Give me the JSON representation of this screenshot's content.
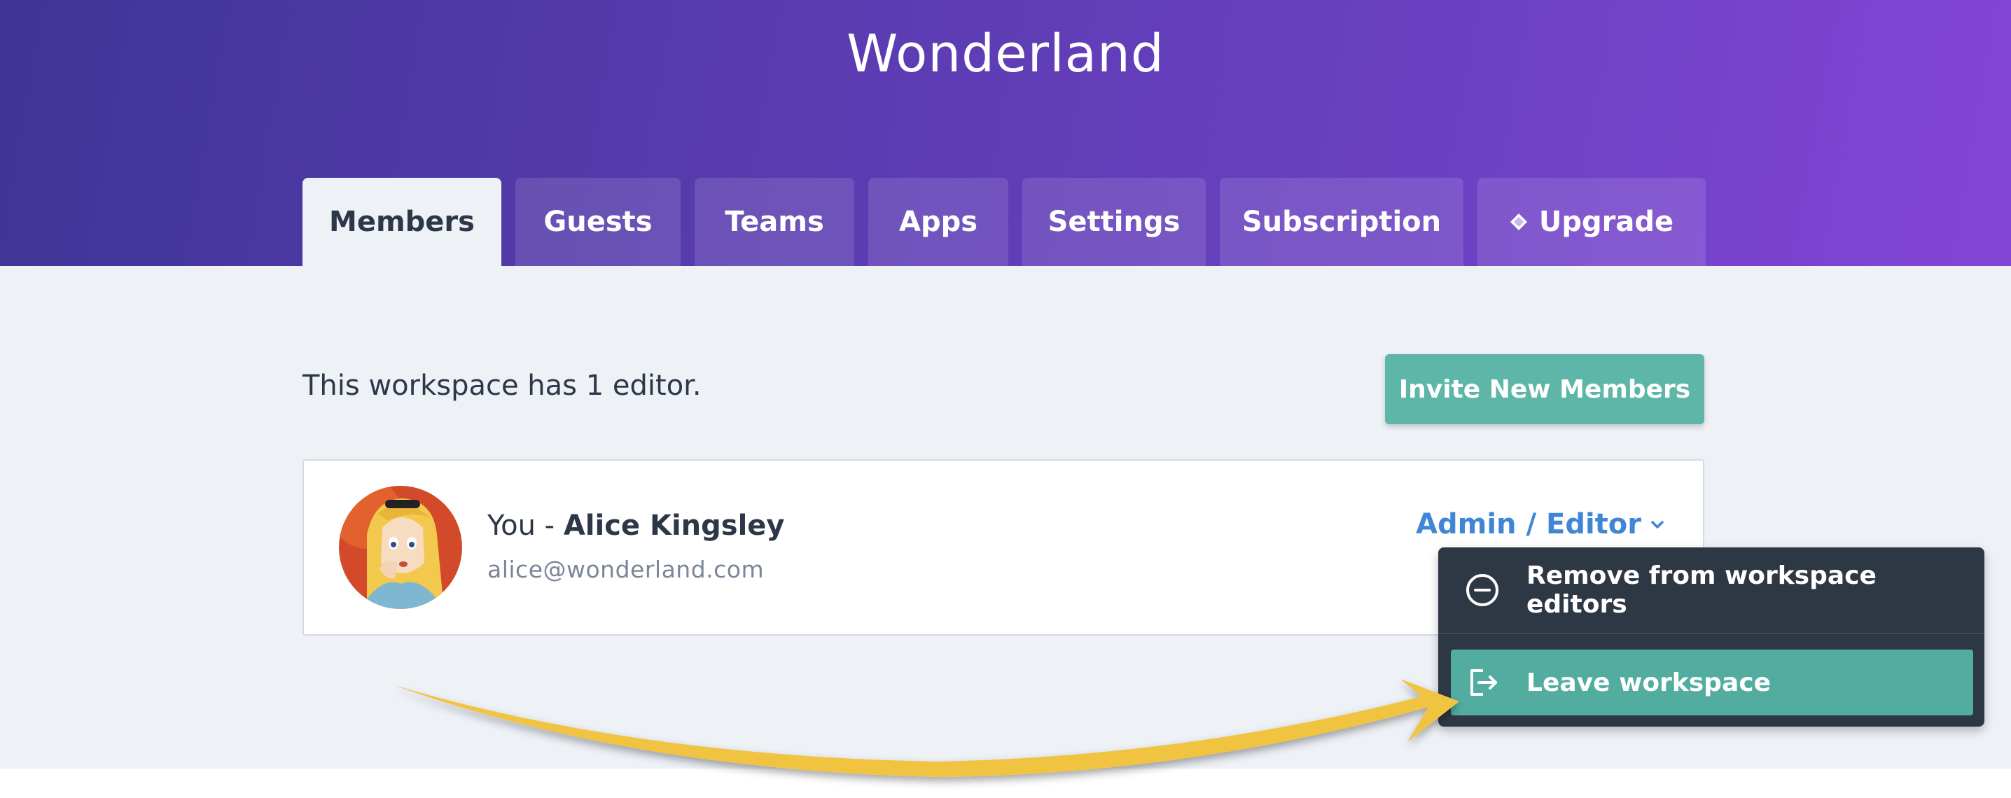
{
  "workspace": {
    "title": "Wonderland"
  },
  "tabs": [
    {
      "label": "Members",
      "active": true
    },
    {
      "label": "Guests",
      "active": false
    },
    {
      "label": "Teams",
      "active": false
    },
    {
      "label": "Apps",
      "active": false
    },
    {
      "label": "Settings",
      "active": false
    },
    {
      "label": "Subscription",
      "active": false
    },
    {
      "label": "Upgrade",
      "active": false,
      "icon": "diamond-icon"
    }
  ],
  "members": {
    "summary": "This workspace has 1 editor.",
    "invite_label": "Invite New Members",
    "list": [
      {
        "prefix": "You - ",
        "name": "Alice Kingsley",
        "email": "alice@wonderland.com",
        "role": "Admin / Editor",
        "avatar": "avatar-alice"
      }
    ]
  },
  "role_menu": {
    "items": [
      {
        "label": "Remove from workspace editors",
        "icon": "minus-circle-icon"
      },
      {
        "label": "Leave workspace",
        "icon": "exit-icon",
        "highlighted": true
      }
    ]
  },
  "colors": {
    "header_start": "#3f3596",
    "header_end": "#8345d6",
    "accent_teal": "#5db6a7",
    "link_blue": "#3f86d6",
    "menu_bg": "#2e3845",
    "annotation_arrow": "#f0c43f"
  }
}
